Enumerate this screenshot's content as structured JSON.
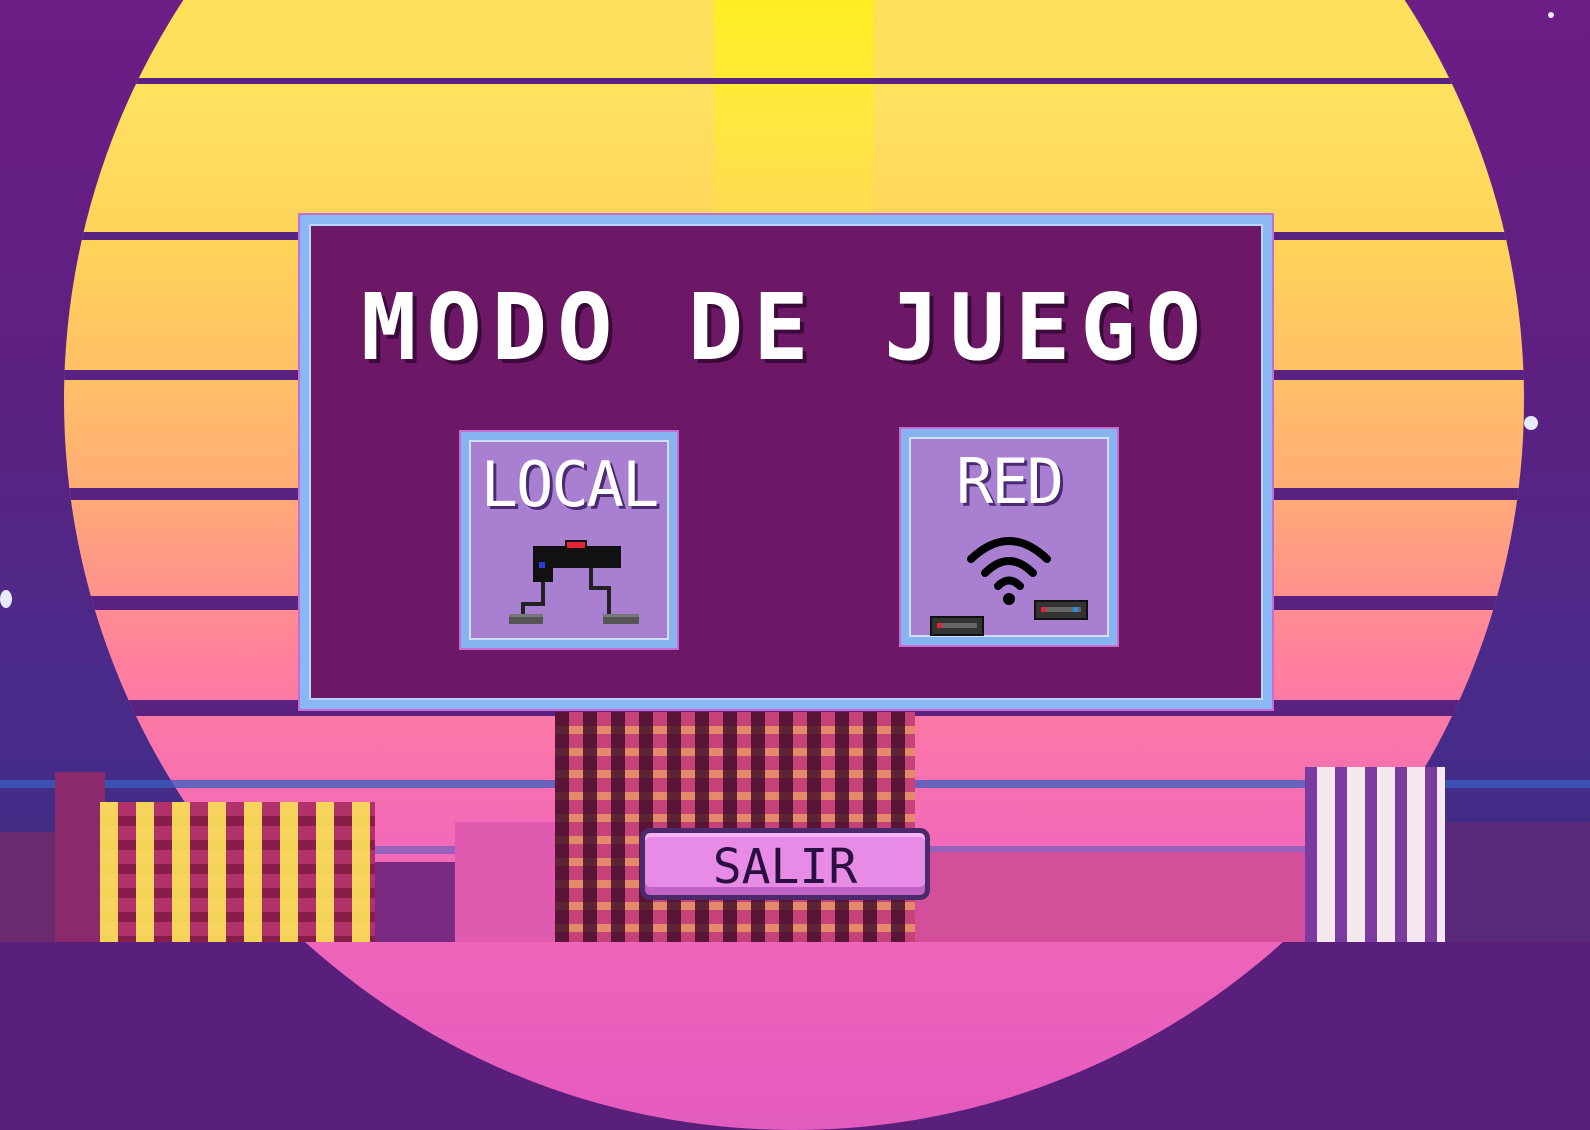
{
  "screen": {
    "title": "MODO DE JUEGO",
    "buttons": {
      "local": {
        "label": "LOCAL",
        "icon": "console-controllers-icon"
      },
      "red": {
        "label": "RED",
        "icon": "wifi-network-icon"
      }
    },
    "exit_button": {
      "label": "SALIR"
    }
  },
  "colors": {
    "panel_bg": "#6c1866",
    "panel_border": "#8ab8f4",
    "button_bg": "#a97fd2",
    "exit_bg": "#e88be6",
    "sun_top": "#ffe24a",
    "sun_bottom": "#e45bbf",
    "sky": "#5c2080"
  }
}
